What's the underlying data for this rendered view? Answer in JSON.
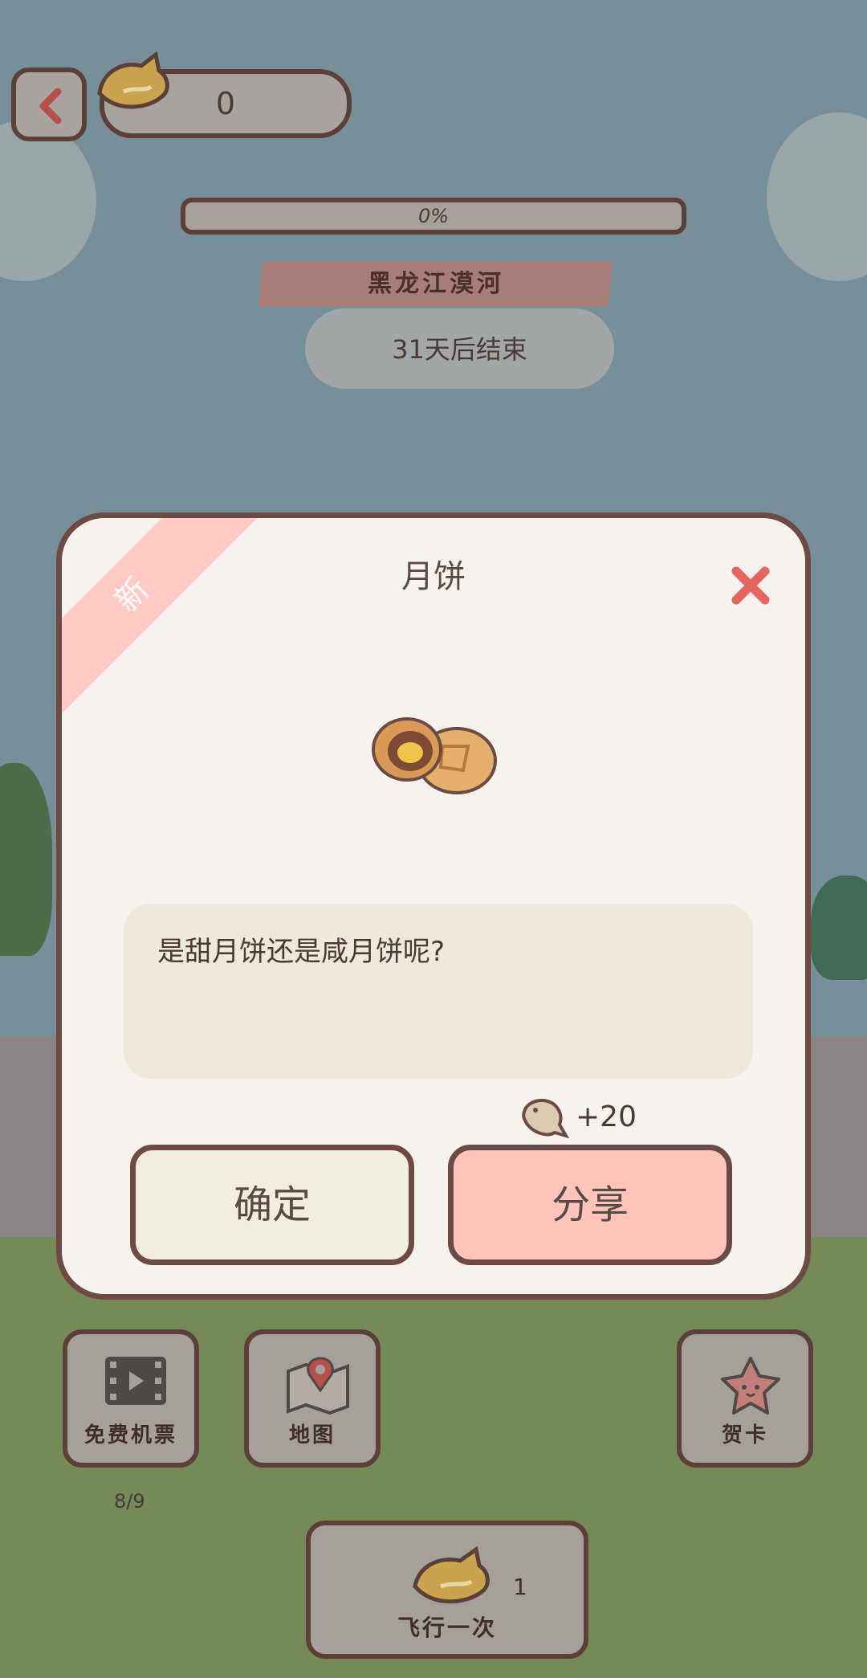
{
  "header": {
    "coin_count": "0",
    "progress_text": "0%",
    "progress_value": 0,
    "location": "黑龙江漠河",
    "ends_text": "31天后结束"
  },
  "dialog": {
    "badge": "新",
    "title": "月饼",
    "description": "是甜月饼还是咸月饼呢?",
    "reward": "+20",
    "confirm_label": "确定",
    "share_label": "分享"
  },
  "bottom": {
    "free_ticket_label": "免费机票",
    "free_ticket_count": "8/9",
    "map_label": "地图",
    "card_label": "贺卡",
    "fly_label": "飞行一次",
    "fly_count": "1"
  },
  "colors": {
    "accent_pink": "#ffc5b9",
    "close_red": "#e8655f",
    "border_brown": "#6b4b44"
  },
  "icons": [
    "back-arrow-icon",
    "goldfish-icon",
    "close-icon",
    "mooncake-icon",
    "fish-icon",
    "film-icon",
    "map-pin-icon",
    "star-icon"
  ]
}
